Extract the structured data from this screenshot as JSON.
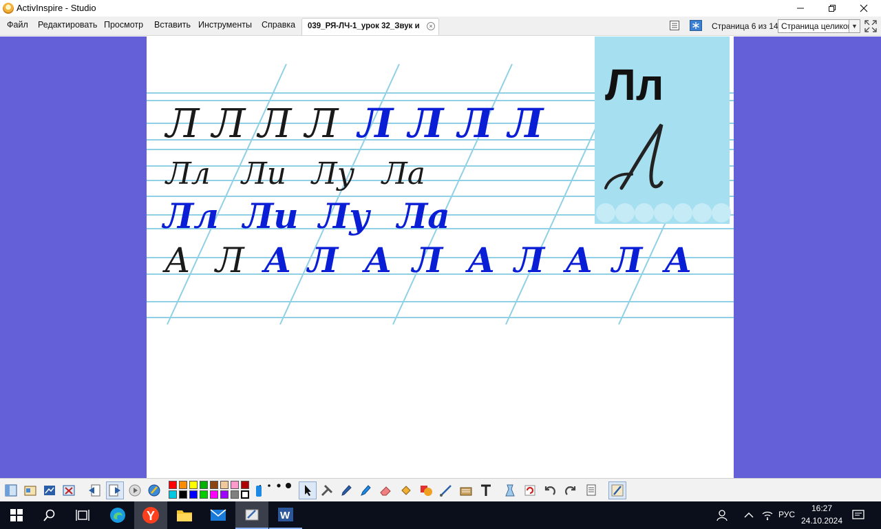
{
  "window": {
    "title": "ActivInspire - Studio",
    "controls": [
      "minimize",
      "restore",
      "close"
    ]
  },
  "menu": [
    "Файл",
    "Редактировать",
    "Просмотр",
    "Вставить",
    "Инструменты",
    "Справка"
  ],
  "document_tab": {
    "label": "039_РЯ-ЛЧ-1_урок 32_Звук и",
    "close_icon": "close-circle-icon"
  },
  "page_counter": "Страница 6 из 14",
  "zoom": {
    "selected": "Страница целиком"
  },
  "colors": {
    "workspace": "#6360d8",
    "ink_blue": "#0a1ed6",
    "ink_black": "#1a1a1a",
    "guide_line": "#8fd0e6",
    "card": "#a6dff0"
  },
  "flipchart": {
    "card_letters": "Лл",
    "rows": [
      {
        "items": [
          {
            "text": "Л",
            "ink": "black"
          },
          {
            "text": "Л",
            "ink": "black"
          },
          {
            "text": "Л",
            "ink": "black"
          },
          {
            "text": "Л",
            "ink": "black"
          },
          {
            "text": "Л",
            "ink": "blue"
          },
          {
            "text": "Л",
            "ink": "blue"
          },
          {
            "text": "Л",
            "ink": "blue"
          },
          {
            "text": "Л",
            "ink": "blue"
          }
        ]
      },
      {
        "items": [
          {
            "text": "Лл",
            "ink": "black"
          },
          {
            "text": "Ли",
            "ink": "black"
          },
          {
            "text": "Лу",
            "ink": "black"
          },
          {
            "text": "Ла",
            "ink": "black"
          }
        ]
      },
      {
        "items": [
          {
            "text": "Лл",
            "ink": "blue"
          },
          {
            "text": "Ли",
            "ink": "blue"
          },
          {
            "text": "Лу",
            "ink": "blue"
          },
          {
            "text": "Ла",
            "ink": "blue"
          }
        ]
      },
      {
        "items": [
          {
            "text": "А",
            "ink": "black"
          },
          {
            "text": "Л",
            "ink": "black"
          },
          {
            "text": "А",
            "ink": "blue"
          },
          {
            "text": "Л",
            "ink": "blue"
          },
          {
            "text": "А",
            "ink": "blue"
          },
          {
            "text": "Л",
            "ink": "blue"
          },
          {
            "text": "А",
            "ink": "blue"
          },
          {
            "text": "Л",
            "ink": "blue"
          },
          {
            "text": "А",
            "ink": "blue"
          },
          {
            "text": "Л",
            "ink": "blue"
          },
          {
            "text": "А",
            "ink": "blue"
          }
        ]
      }
    ]
  },
  "toolbar": {
    "left_icons": [
      "browsers-icon",
      "resource-library-icon",
      "properties-icon",
      "action-browser-icon",
      "previous-page-icon",
      "next-page-icon",
      "play-icon",
      "desktop-annotate-icon"
    ],
    "palette": [
      "#ff0000",
      "#ff8c00",
      "#ffff00",
      "#00b000",
      "#8b4513",
      "#f0c89a",
      "#ff99cc",
      "#b00000",
      "#00c8e0",
      "#000000",
      "#0000ff",
      "#00cc00",
      "#ff00ff",
      "#a000ff",
      "#808080",
      "#ffffff"
    ],
    "tool_icons": [
      "select-icon",
      "tools-icon",
      "pen-icon",
      "highlighter-icon",
      "eraser-icon",
      "fill-icon",
      "shape-icon",
      "connector-icon",
      "magic-ink-icon",
      "text-tool-icon",
      "clear-icon",
      "reset-page-icon",
      "undo-icon",
      "redo-icon",
      "page-icon",
      "dual-user-icon"
    ]
  },
  "taskbar": {
    "apps": [
      "windows-start-icon",
      "search-icon",
      "task-view-icon",
      "edge-icon",
      "yandex-browser-icon",
      "file-explorer-icon",
      "mail-icon",
      "activinspire-icon",
      "word-icon"
    ],
    "language": "РУС",
    "time": "16:27",
    "date": "24.10.2024"
  }
}
